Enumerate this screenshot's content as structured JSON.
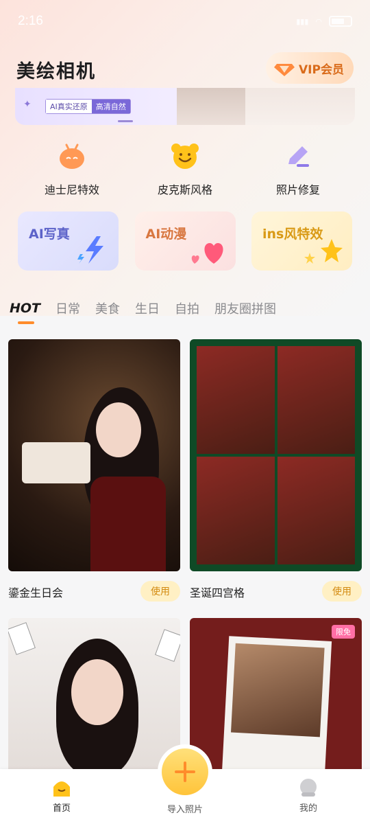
{
  "status": {
    "time": "2:16",
    "battery": "100"
  },
  "app_title": "美绘相机",
  "vip_label": "VIP会员",
  "banner": {
    "tag_left": "AI真实还原",
    "tag_right": "高清自然"
  },
  "features": [
    {
      "label": "迪士尼特效",
      "icon": "orange-bot-icon"
    },
    {
      "label": "皮克斯风格",
      "icon": "yellow-bear-icon"
    },
    {
      "label": "照片修复",
      "icon": "purple-pen-icon"
    }
  ],
  "cards": [
    {
      "label": "AI写真"
    },
    {
      "label": "AI动漫"
    },
    {
      "label": "ins风特效"
    }
  ],
  "tabs": [
    "HOT",
    "日常",
    "美食",
    "生日",
    "自拍",
    "朋友圈拼图"
  ],
  "templates": [
    {
      "name": "鎏金生日会",
      "action": "使用"
    },
    {
      "name": "圣诞四宫格",
      "action": "使用"
    }
  ],
  "badge_label": "限免",
  "nav": {
    "home": "首页",
    "import": "导入照片",
    "mine": "我的"
  },
  "colors": {
    "accent": "#ff8c2b",
    "use_bg": "#fff0c4",
    "plus": "#ffc43a"
  }
}
